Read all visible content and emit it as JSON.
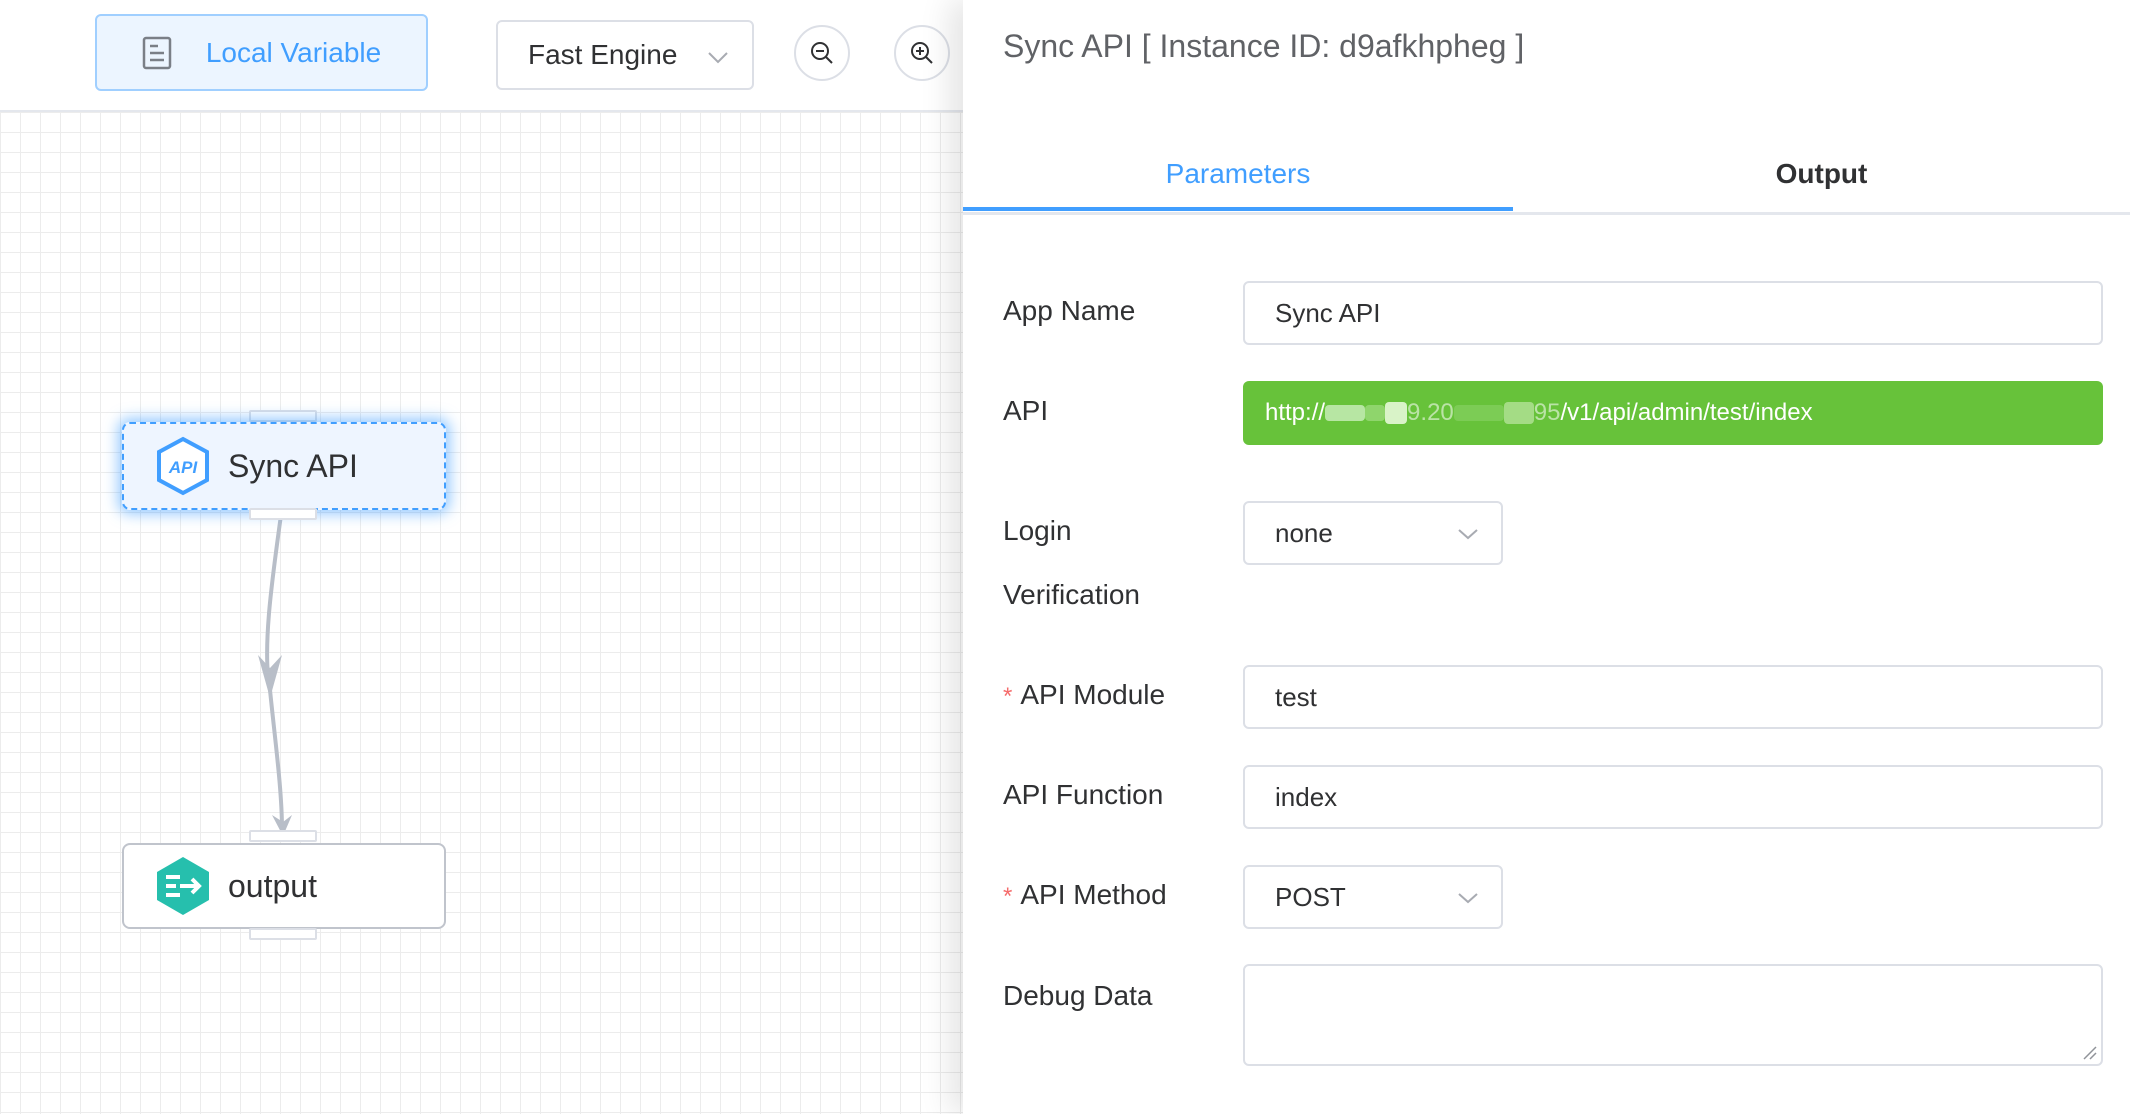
{
  "toolbar": {
    "local_variable_label": "Local Variable",
    "engine_select_value": "Fast Engine",
    "zoom_out_icon": "zoom-out-icon",
    "zoom_in_icon": "zoom-in-icon"
  },
  "canvas": {
    "nodes": [
      {
        "label": "Sync API",
        "icon": "api-icon",
        "selected": true
      },
      {
        "label": "output",
        "icon": "output-icon",
        "selected": false
      }
    ]
  },
  "panel": {
    "title": "Sync API [ Instance ID: d9afkhpheg ]",
    "tabs": [
      {
        "label": "Parameters",
        "active": true
      },
      {
        "label": "Output",
        "active": false
      }
    ],
    "form": {
      "app_name": {
        "label": "App Name",
        "value": "Sync API"
      },
      "api": {
        "label": "API",
        "value_prefix": "http://",
        "value_masked_part": "9.20",
        "value_masked_port": "95",
        "value_suffix": "/v1/api/admin/test/index"
      },
      "login_verification": {
        "label_line1": "Login",
        "label_line2": "Verification",
        "value": "none"
      },
      "api_module": {
        "label": "API Module",
        "required": true,
        "value": "test"
      },
      "api_function": {
        "label": "API Function",
        "value": "index"
      },
      "api_method": {
        "label": "API Method",
        "required": true,
        "value": "POST"
      },
      "debug_data": {
        "label": "Debug Data",
        "value": ""
      }
    }
  },
  "colors": {
    "primary": "#409eff",
    "success": "#67c23a",
    "danger": "#f56c6c",
    "output_node": "#26bfad"
  }
}
